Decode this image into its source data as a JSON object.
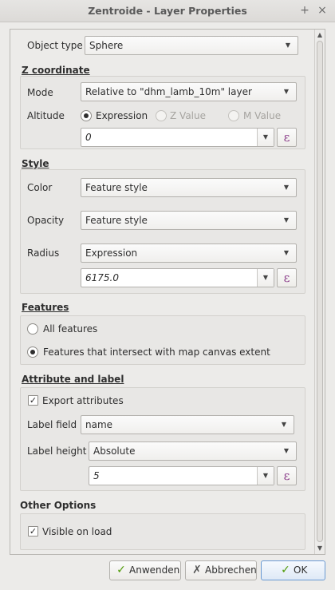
{
  "window": {
    "title": "Zentroide - Layer Properties",
    "pin_icon": "+",
    "close_icon": "×"
  },
  "object_type": {
    "label": "Object type",
    "value": "Sphere"
  },
  "z_coordinate": {
    "title": "Z coordinate",
    "mode_label": "Mode",
    "mode_value": "Relative to \"dhm_lamb_10m\" layer",
    "altitude_label": "Altitude",
    "radio_expression": "Expression",
    "radio_z_value": "Z Value",
    "radio_m_value": "M Value",
    "expression_value": "0"
  },
  "style": {
    "title": "Style",
    "color_label": "Color",
    "color_value": "Feature style",
    "opacity_label": "Opacity",
    "opacity_value": "Feature style",
    "radius_label": "Radius",
    "radius_value": "Expression",
    "radius_expression": "6175.0"
  },
  "features": {
    "title": "Features",
    "all_features": "All features",
    "intersect_features": "Features that intersect with map canvas extent"
  },
  "attribute_label": {
    "title": "Attribute and label",
    "export_attributes": "Export attributes",
    "label_field_label": "Label field",
    "label_field_value": "name",
    "label_height_label": "Label height",
    "label_height_value": "Absolute",
    "label_height_expression": "5"
  },
  "other_options": {
    "title": "Other Options",
    "visible_on_load": "Visible on load"
  },
  "buttons": {
    "apply": "Anwenden",
    "cancel": "Abbrechen",
    "ok": "OK"
  },
  "icons": {
    "dropdown": "▼",
    "scroll_up": "▲",
    "scroll_down": "▼",
    "expression": "ε",
    "check": "✓",
    "cross": "✗"
  },
  "colors": {
    "check_green": "#4e9a06",
    "cross_dark": "#555555",
    "expression_purple": "#8a3c8a"
  }
}
